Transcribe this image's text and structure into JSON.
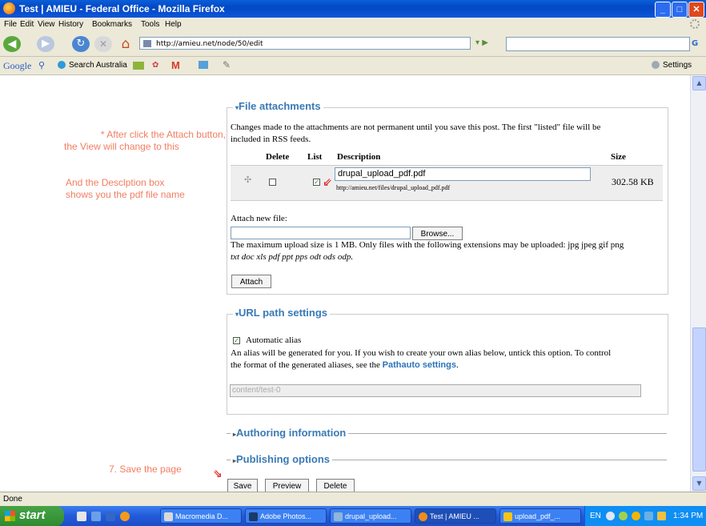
{
  "window": {
    "title": "Test | AMIEU - Federal Office - Mozilla Firefox"
  },
  "menu": [
    "File",
    "Edit",
    "View",
    "History",
    "Bookmarks",
    "Tools",
    "Help"
  ],
  "nav": {
    "url": "http://amieu.net/node/50/edit"
  },
  "google_bar": {
    "search_label": "Search Australia",
    "settings_label": "Settings"
  },
  "annotations": {
    "note1_line1": "* After click the Attach button,",
    "note1_line2": "the View will change to this",
    "note2_line1": "And the Desclption box",
    "note2_line2": "shows you the pdf file name",
    "note3": "7. Save the page"
  },
  "attachments": {
    "legend": "File attachments",
    "intro_line1": "Changes made to the attachments are not permanent until you save this post. The first \"listed\" file will be",
    "intro_line2": "included in RSS feeds.",
    "col_delete": "Delete",
    "col_list": "List",
    "col_description": "Description",
    "col_size": "Size",
    "file_description": "drupal_upload_pdf.pdf",
    "file_url": "http://amieu.net/files/drupal_upload_pdf.pdf",
    "file_size": "302.58 KB",
    "attach_new_label": "Attach new file:",
    "browse_button": "Browse...",
    "max_info_line1": "The maximum upload size is 1 MB. Only files with the following extensions may be uploaded: jpg jpeg gif png",
    "max_info_line2": "txt doc xls pdf ppt pps odt ods odp.",
    "attach_button": "Attach"
  },
  "url_path": {
    "legend": "URL path settings",
    "auto_alias_label": "Automatic alias",
    "help_line1": "An alias will be generated for you. If you wish to create your own alias below, untick this option. To control",
    "help_line2_prefix": "the format of the generated aliases, see the",
    "help_link": "Pathauto settings",
    "help_line2_suffix": ".",
    "alias_value": "content/test-0"
  },
  "sections": {
    "authoring": "Authoring information",
    "publishing": "Publishing options"
  },
  "actions": {
    "save": "Save",
    "preview": "Preview",
    "delete": "Delete"
  },
  "status": {
    "text": "Done"
  },
  "taskbar": {
    "start": "start",
    "tasks": [
      "Macromedia D...",
      "Adobe Photos...",
      "drupal_upload...",
      "Test | AMIEU ...",
      "upload_pdf_..."
    ],
    "lang": "EN",
    "clock": "1:34 PM"
  }
}
